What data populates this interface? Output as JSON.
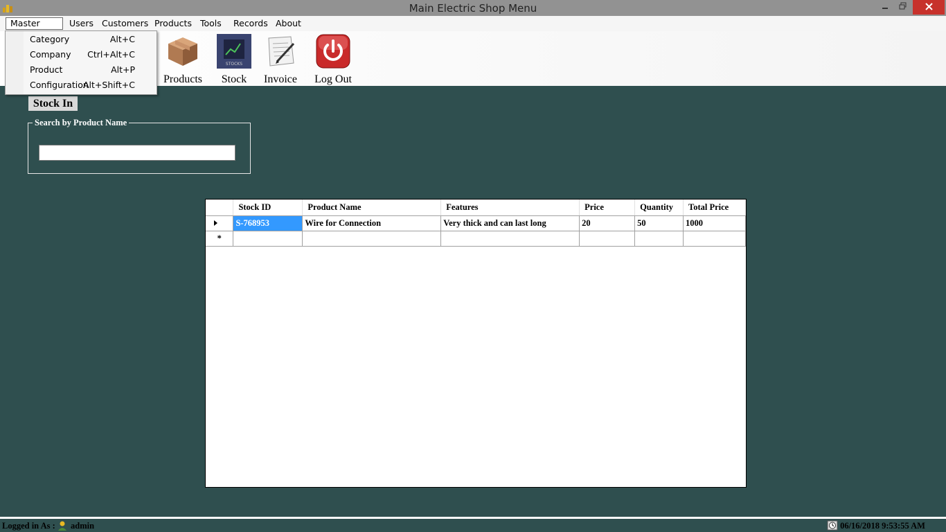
{
  "window": {
    "title": "Main Electric Shop Menu"
  },
  "menubar": {
    "items": [
      {
        "label": "Master Entry"
      },
      {
        "label": "Users"
      },
      {
        "label": "Customers"
      },
      {
        "label": "Products"
      },
      {
        "label": "Tools"
      },
      {
        "label": "Records"
      },
      {
        "label": "About"
      }
    ]
  },
  "dropdown": {
    "items": [
      {
        "label": "Category",
        "shortcut": "Alt+C"
      },
      {
        "label": "Company",
        "shortcut": "Ctrl+Alt+C"
      },
      {
        "label": "Product",
        "shortcut": "Alt+P"
      },
      {
        "label": "Configuration",
        "shortcut": "Alt+Shift+C"
      }
    ]
  },
  "toolbar": {
    "products_label": "Products",
    "stock_label": "Stock",
    "stock_icon_text": "STOCKS",
    "invoice_label": "Invoice",
    "logout_label": "Log Out"
  },
  "page": {
    "heading": "Stock In",
    "search_legend": "Search by Product Name",
    "search_value": ""
  },
  "grid": {
    "columns": [
      "Stock ID",
      "Product Name",
      "Features",
      "Price",
      "Quantity",
      "Total Price"
    ],
    "rows": [
      [
        "S-768953",
        "Wire for Connection",
        "Very thick and can last long",
        "20",
        "50",
        "1000"
      ]
    ],
    "new_row_marker": "*"
  },
  "status": {
    "logged_in_label": "Logged in As :",
    "user": "admin",
    "datetime": "06/16/2018 9:53:55 AM"
  },
  "colors": {
    "background": "#2f4f4f",
    "selected_cell": "#3399ff",
    "close_button": "#c7312b"
  }
}
